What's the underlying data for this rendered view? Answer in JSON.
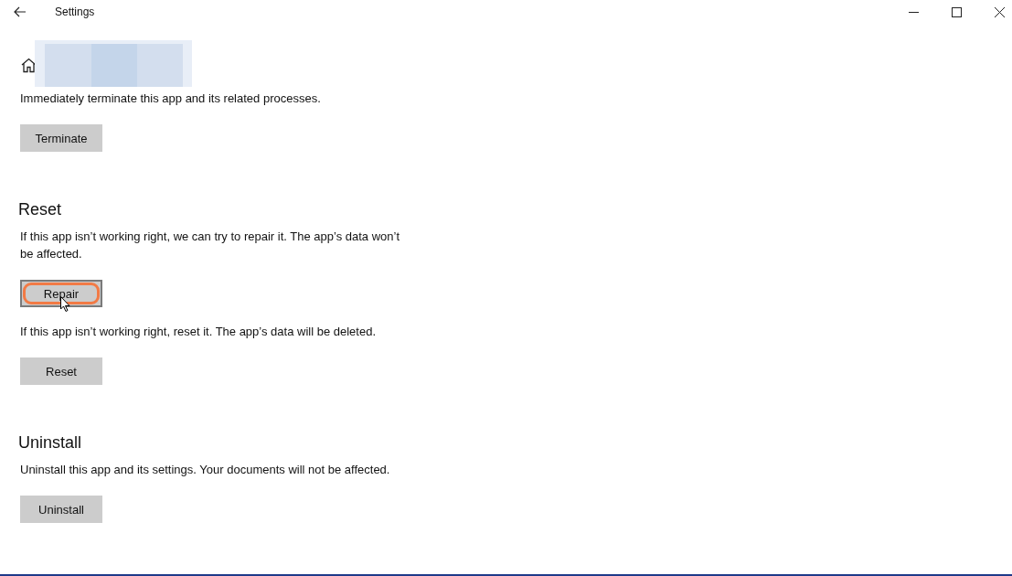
{
  "window": {
    "title": "Settings"
  },
  "blocks": [
    {
      "kind": "text",
      "text": "Immediately terminate this app and its related processes."
    },
    {
      "kind": "button",
      "label": "Terminate",
      "highlighted": false
    },
    {
      "kind": "heading",
      "text": "Reset"
    },
    {
      "kind": "text",
      "text": "If this app isn’t working right, we can try to repair it. The app’s data won’t be affected."
    },
    {
      "kind": "button",
      "label": "Repair",
      "highlighted": true
    },
    {
      "kind": "text",
      "text": "If this app isn’t working right, reset it. The app’s data will be deleted."
    },
    {
      "kind": "button",
      "label": "Reset",
      "highlighted": false
    },
    {
      "kind": "heading",
      "text": "Uninstall"
    },
    {
      "kind": "text",
      "text": "Uninstall this app and its settings. Your documents will not be affected."
    },
    {
      "kind": "button",
      "label": "Uninstall",
      "highlighted": false
    }
  ]
}
